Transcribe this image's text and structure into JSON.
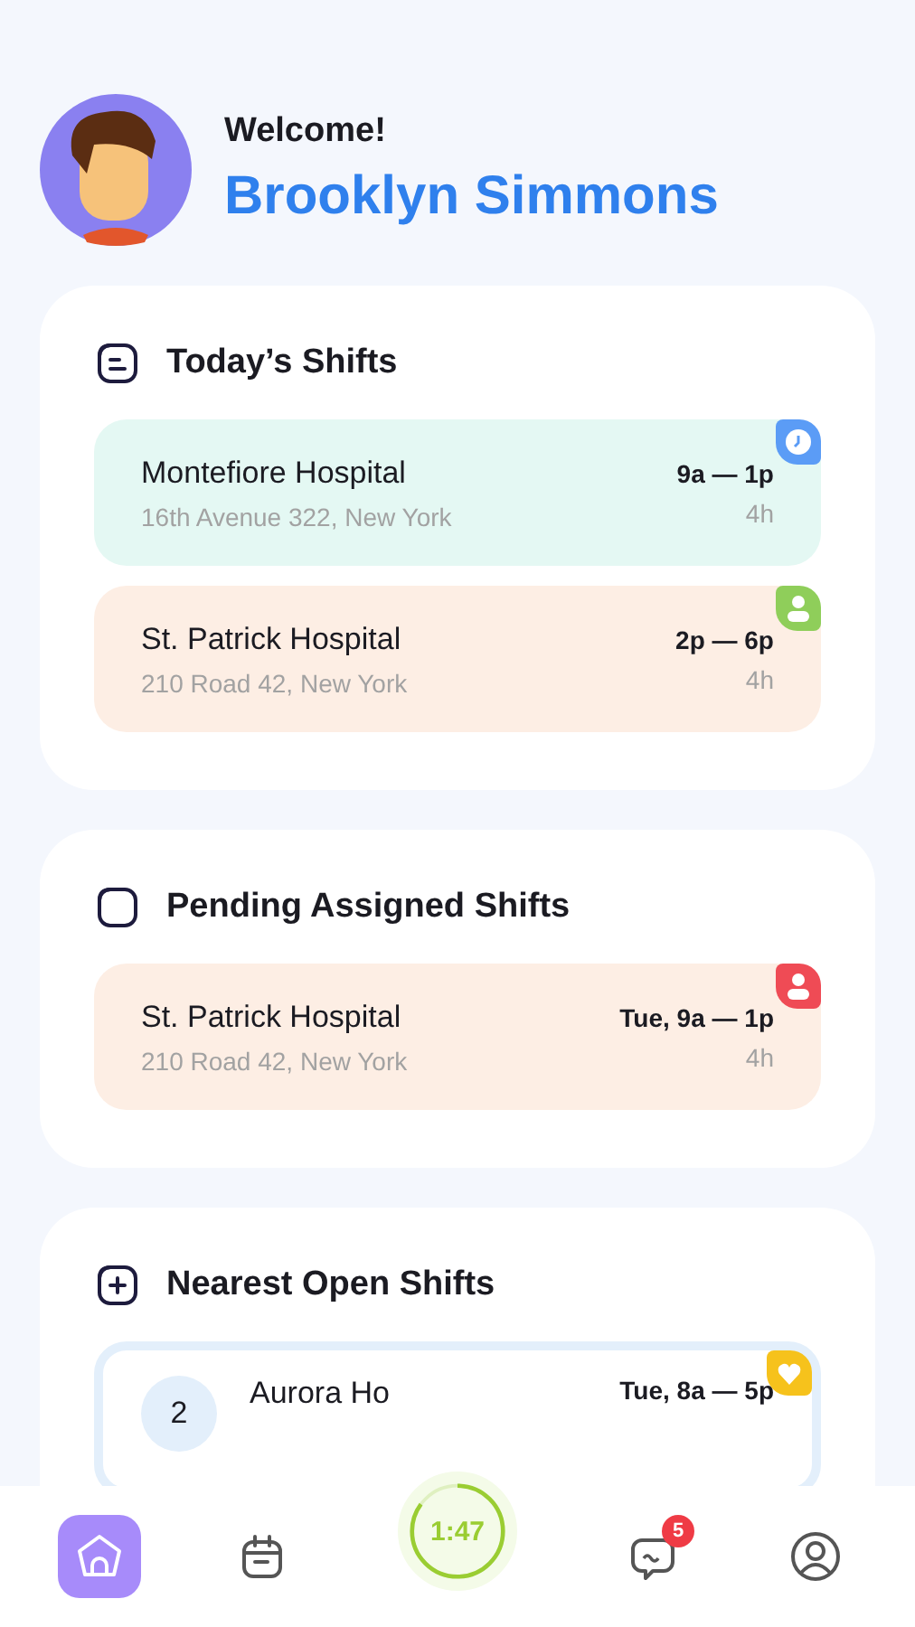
{
  "header": {
    "greeting": "Welcome!",
    "name": "Brooklyn Simmons"
  },
  "sections": [
    {
      "title": "Today’s Shifts",
      "shifts": [
        {
          "kind": "current",
          "name": "Montefiore Hospital",
          "address": "16th Avenue 322, New York",
          "time": "9a — 1p",
          "duration": "4h",
          "badge": {
            "color": "#5b9cf6"
          }
        },
        {
          "kind": "later",
          "name": "St. Patrick Hospital",
          "address": "210 Road 42, New York",
          "time": "2p — 6p",
          "duration": "4h",
          "badge": {
            "color": "#8fce5a"
          }
        }
      ]
    },
    {
      "title": "Pending Assigned Shifts",
      "shifts": [
        {
          "kind": "later",
          "name": "St. Patrick Hospital",
          "address": "210 Road 42, New York",
          "time": "Tue, 9a — 1p",
          "duration": "4h",
          "badge": {
            "color": "#ef4b55"
          }
        }
      ]
    },
    {
      "title": "Nearest Open Shifts",
      "shifts": [
        {
          "kind": "open",
          "number": "2",
          "name": "Aurora Ho",
          "time": "Tue, 8a — 5p",
          "badge": {
            "color": "#f6c21c"
          }
        }
      ]
    }
  ],
  "nav": [
    {
      "kind": "home",
      "selected": true
    },
    {
      "kind": "calendar",
      "selected": false
    },
    {
      "kind": "timer",
      "label": "1:47"
    },
    {
      "kind": "chat",
      "selected": false,
      "count": "5"
    },
    {
      "kind": "profile",
      "selected": false
    }
  ]
}
